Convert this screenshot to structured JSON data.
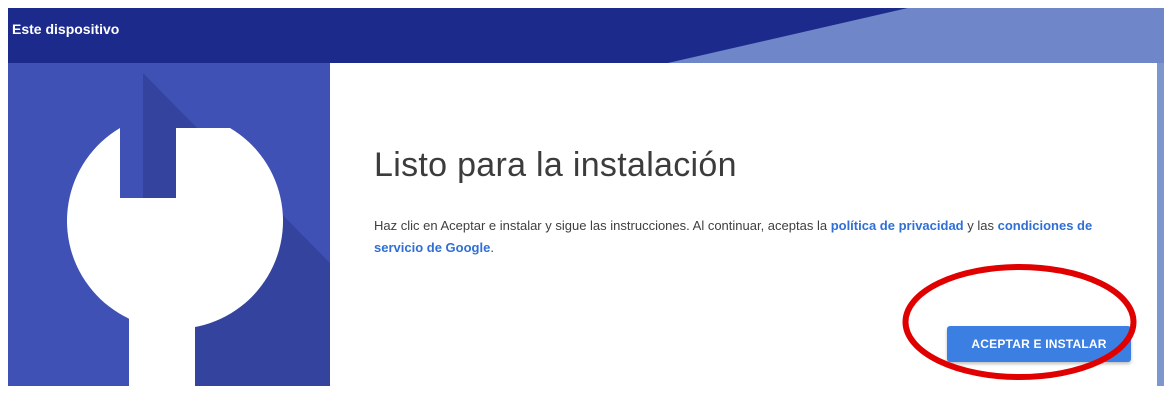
{
  "header": {
    "title": "Este dispositivo"
  },
  "card": {
    "title": "Listo para la instalación",
    "text_before_link1": "Haz clic en Aceptar e instalar y sigue las instrucciones. Al continuar, aceptas la ",
    "link1": "política de privacidad",
    "text_between": " y las ",
    "link2": "condiciones de servicio de Google",
    "text_after": ".",
    "button_label": "ACEPTAR E INSTALAR"
  },
  "icons": {
    "main": "wrench-icon"
  },
  "annotation": {
    "highlight_color": "#e00000"
  },
  "colors": {
    "background_blue": "#3a57b8",
    "header_dark_blue": "#1c2a8c",
    "icon_panel_blue": "#3f51b5",
    "link_blue": "#2f6fd6",
    "button_blue": "#3c7fe3"
  }
}
